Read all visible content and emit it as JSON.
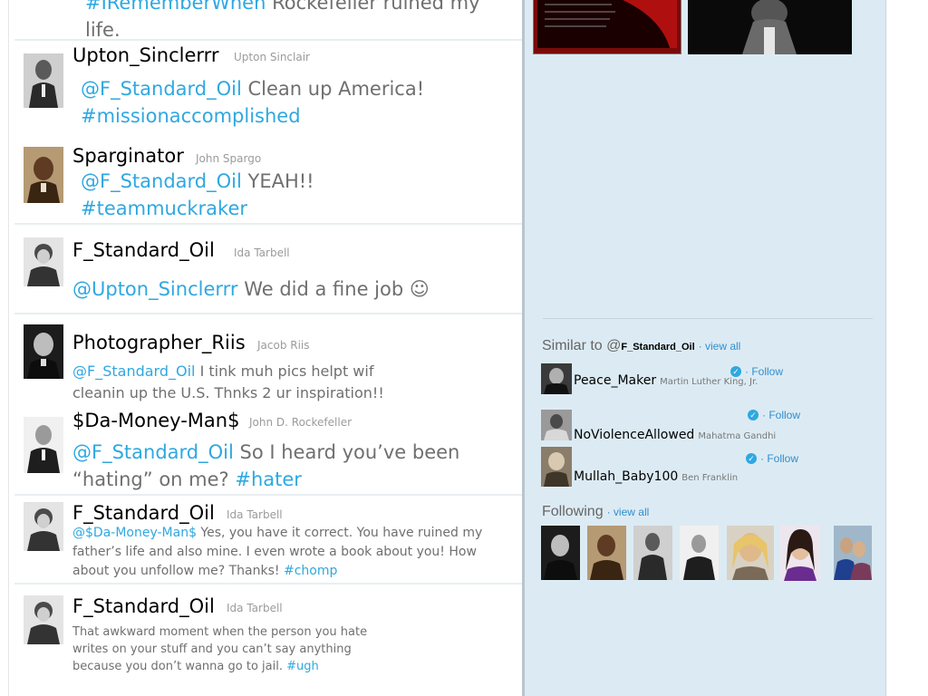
{
  "feed": {
    "top_tweet": {
      "hashtag": "#IRememberWhen",
      "text_line1": " Rockefeller ruined my",
      "text_line2": "life."
    },
    "tweets": [
      {
        "username": "Upton_Sinclerrr",
        "fullname": "Upton Sinclair",
        "mention": "@F_Standard_Oil",
        "line1": "  Clean up America!",
        "line2_tag": "#missionaccomplished"
      },
      {
        "username": "Sparginator",
        "fullname": "John Spargo",
        "mention": "@F_Standard_Oil",
        "line1": " YEAH!!",
        "line2_tag": "#teammuckraker"
      },
      {
        "username": "F_Standard_Oil",
        "fullname": "Ida Tarbell",
        "mention": "@Upton_Sinclerrr",
        "line1": " We did a fine job ☺"
      },
      {
        "username": "Photographer_Riis",
        "fullname": "Jacob Riis",
        "mention": "@F_Standard_Oil",
        "line1": " I tink muh pics helpt wif",
        "line2": "cleanin up the U.S. Thnks 2 ur inspiration!!"
      },
      {
        "username": "$Da-Money-Man$",
        "fullname": "John D. Rockefeller",
        "mention": "@F_Standard_Oil",
        "line1": " So I heard you’ve been",
        "line2": "“hating” on me? ",
        "line2_tag": "#hater"
      },
      {
        "username": "F_Standard_Oil",
        "fullname": "Ida Tarbell",
        "mention": "@$Da-Money-Man$",
        "line1": " Yes, you have it correct. You have ruined my",
        "line2": "father’s life and also mine. I even wrote a book about you! How",
        "line3": "about you unfollow me? Thanks! ",
        "line3_tag": "#chomp"
      },
      {
        "username": "F_Standard_Oil",
        "fullname": "Ida Tarbell",
        "line1": "That awkward moment when the person you hate",
        "line2": "writes on your stuff and you can’t say anything",
        "line3": "because you don’t wanna go to jail. ",
        "line3_tag": "#ugh"
      }
    ]
  },
  "sidebar": {
    "similar": {
      "title": "Similar to @",
      "handle": "F_Standard_Oil",
      "view_all": "· view all",
      "users": [
        {
          "username": "Peace_Maker",
          "fullname": "Martin Luther King, Jr.",
          "follow": "· Follow"
        },
        {
          "username": "NoViolenceAllowed",
          "fullname": "Mahatma Gandhi",
          "follow": "· Follow"
        },
        {
          "username": "Mullah_Baby100",
          "fullname": "Ben Franklin",
          "follow": "· Follow"
        }
      ]
    },
    "following": {
      "title": "Following",
      "view_all": "· view all"
    }
  },
  "colors": {
    "link": "#2fa8e0",
    "sidebar_bg": "#dcebf3",
    "text_gray": "#6f6f6f"
  }
}
